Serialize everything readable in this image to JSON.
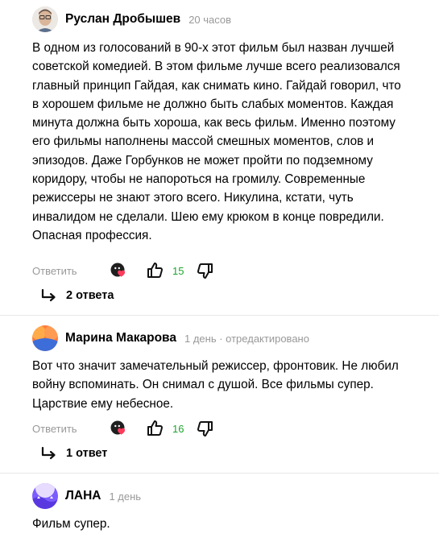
{
  "comments": [
    {
      "author": "Руслан Дробышев",
      "time": "20 часов",
      "text": "В одном из голосований в 90-х этот фильм был назван лучшей советской комедией. В этом фильме лучше всего реализовался главный принцип Гайдая, как снимать кино. Гайдай говорил, что в хорошем фильме не должно быть слабых моментов. Каждая минута должна быть хороша, как весь фильм. Именно поэтому его фильмы наполнены массой смешных моментов, слов и эпизодов. Даже Горбунков не может пройти по подземному коридору, чтобы не напороться на громилу. Современные режиссеры не знают этого всего. Никулина, кстати, чуть инвалидом не сделали. Шею ему крюком в конце повредили. Опасная профессия.",
      "reply_label": "Ответить",
      "likes": "15",
      "replies_label": "2 ответа",
      "avatar_icon": "man-avatar"
    },
    {
      "author": "Марина Макарова",
      "time": "1 день · отредактировано",
      "text": "Вот что значит замечательный режиссер, фронтовик. Не любил войну вспоминать. Он снимал с душой. Все фильмы супер. Царствие ему небесное.",
      "reply_label": "Ответить",
      "likes": "16",
      "replies_label": "1 ответ",
      "avatar_icon": "orange-blue-avatar"
    },
    {
      "author": "ЛАНА",
      "time": "1 день",
      "text": "Фильм супер.",
      "avatar_icon": "purple-avatar"
    }
  ],
  "colors": {
    "like_green": "#1ea62e",
    "muted": "#999999",
    "avatar_purple": "#7b5cff",
    "avatar_orange": "#ff7a3c",
    "avatar_blue": "#3d6dd8"
  }
}
